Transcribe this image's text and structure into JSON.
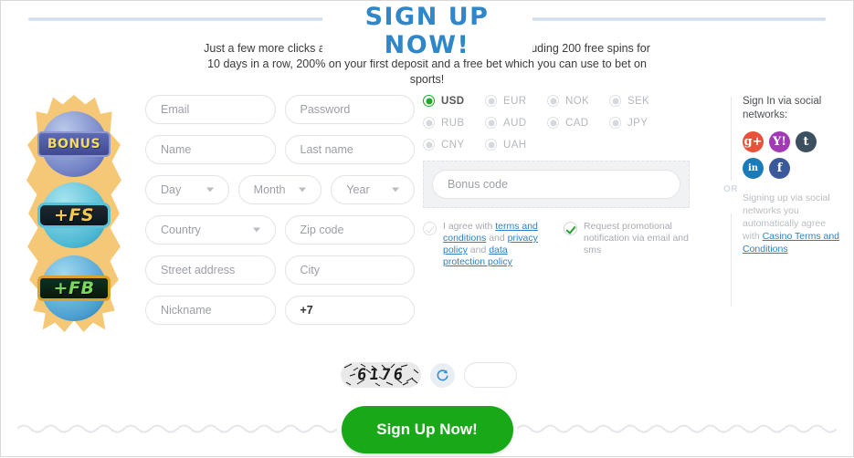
{
  "header": {
    "title": "SIGN UP NOW!",
    "subtitle": "Just a few more clicks and you'll receive a welcome package including 200 free spins for 10 days in a row, 200% on your first deposit and a free bet which you can use to bet on sports!"
  },
  "badges": [
    {
      "label": "BONUS"
    },
    {
      "label": "+FS"
    },
    {
      "label": "+FB"
    }
  ],
  "form": {
    "email": {
      "placeholder": "Email",
      "value": ""
    },
    "password": {
      "placeholder": "Password",
      "value": ""
    },
    "name": {
      "placeholder": "Name",
      "value": ""
    },
    "last_name": {
      "placeholder": "Last name",
      "value": ""
    },
    "day": {
      "placeholder": "Day",
      "value": ""
    },
    "month": {
      "placeholder": "Month",
      "value": ""
    },
    "year": {
      "placeholder": "Year",
      "value": ""
    },
    "country": {
      "placeholder": "Country",
      "value": ""
    },
    "zip": {
      "placeholder": "Zip code",
      "value": ""
    },
    "street": {
      "placeholder": "Street address",
      "value": ""
    },
    "city": {
      "placeholder": "City",
      "value": ""
    },
    "nickname": {
      "placeholder": "Nickname",
      "value": ""
    },
    "phone": {
      "placeholder": "+7",
      "value": "+7"
    }
  },
  "currencies": {
    "selected": "USD",
    "rows": [
      [
        "USD",
        "EUR",
        "NOK",
        "SEK"
      ],
      [
        "RUB",
        "AUD",
        "CAD",
        "JPY"
      ],
      [
        "CNY",
        "UAH"
      ]
    ]
  },
  "bonus": {
    "placeholder": "Bonus code",
    "value": ""
  },
  "terms": {
    "agree": {
      "checked": false,
      "parts": [
        {
          "text": "I agree with ",
          "link": false
        },
        {
          "text": "terms and conditions",
          "link": true
        },
        {
          "text": " and ",
          "link": false
        },
        {
          "text": "privacy policy",
          "link": true
        },
        {
          "text": " and ",
          "link": false
        },
        {
          "text": "data protection policy",
          "link": true
        }
      ]
    },
    "promo": {
      "checked": true,
      "text": "Request promotional notification via email and sms"
    }
  },
  "divider": {
    "label": "OR"
  },
  "social": {
    "title": "Sign In via social networks:",
    "icons": [
      {
        "name": "google-plus-icon",
        "glyph": "g+",
        "color": "#e8513a"
      },
      {
        "name": "yahoo-icon",
        "glyph": "Y!",
        "color": "#a23ab5"
      },
      {
        "name": "tumblr-icon",
        "glyph": "t",
        "color": "#3c5060"
      },
      {
        "name": "linkedin-icon",
        "glyph": "in",
        "color": "#1b7bb9"
      },
      {
        "name": "facebook-icon",
        "glyph": "f",
        "color": "#3a5a9b"
      }
    ],
    "note_prefix": "Signing up via social networks you automatically agree with ",
    "note_link": "Casino Terms and Conditions"
  },
  "captcha": {
    "code": "6176",
    "refresh_icon": "refresh-icon",
    "input_value": ""
  },
  "submit": {
    "label": "Sign Up Now!"
  },
  "colors": {
    "accent_blue": "#2f87c9",
    "green": "#18a818",
    "link_blue": "#2f7fc4"
  }
}
